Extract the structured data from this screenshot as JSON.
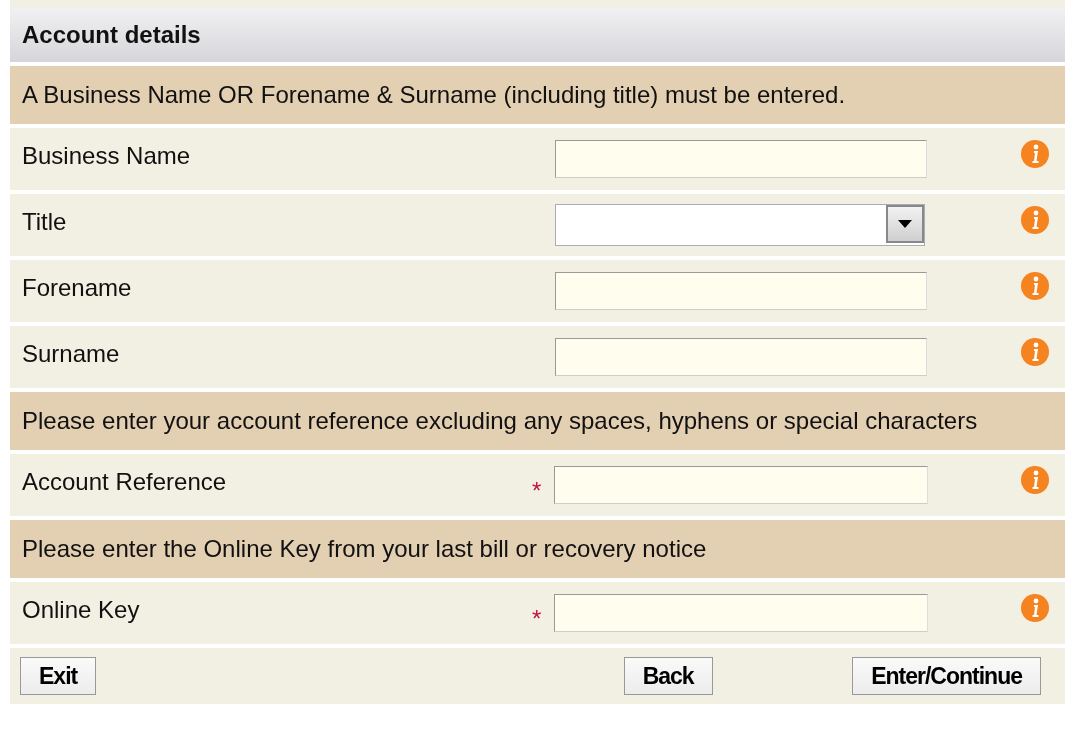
{
  "panel": {
    "title": "Account details"
  },
  "rows": [
    {
      "kind": "note",
      "text": "A Business Name OR Forename & Surname (including title) must be entered."
    },
    {
      "kind": "text",
      "label": "Business Name",
      "required": false
    },
    {
      "kind": "select",
      "label": "Title",
      "required": false
    },
    {
      "kind": "text",
      "label": "Forename",
      "required": false
    },
    {
      "kind": "text",
      "label": "Surname",
      "required": false
    },
    {
      "kind": "note",
      "text": "Please enter your account reference excluding any spaces, hyphens or special characters"
    },
    {
      "kind": "text",
      "label": "Account Reference",
      "required": true,
      "marker": "*"
    },
    {
      "kind": "note",
      "text": "Please enter the Online Key from your last bill or recovery notice"
    },
    {
      "kind": "text",
      "label": "Online Key",
      "required": true,
      "marker": "*"
    }
  ],
  "buttons": [
    "Exit",
    "Back",
    "Enter/Continue"
  ]
}
